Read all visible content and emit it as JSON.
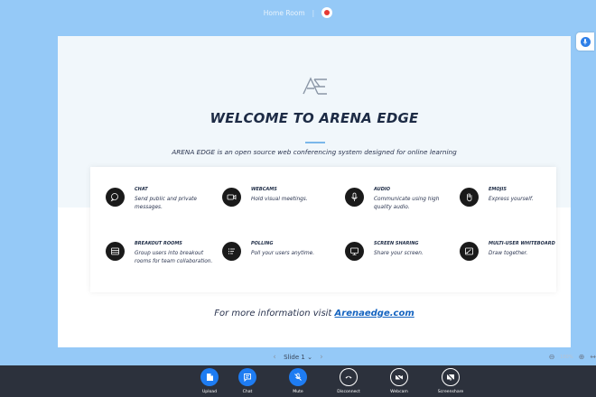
{
  "room": {
    "name": "Home Room",
    "separator": "|"
  },
  "slide": {
    "welcome_title": "WELCOME TO ARENA EDGE",
    "subtitle": "ARENA EDGE is an open source web conferencing system designed for online learning",
    "features": [
      {
        "title": "CHAT",
        "desc": "Send public and private messages.",
        "icon": "chat-bubble-icon"
      },
      {
        "title": "WEBCAMS",
        "desc": "Hold visual meetings.",
        "icon": "webcam-icon"
      },
      {
        "title": "AUDIO",
        "desc": "Communicate using high quality audio.",
        "icon": "microphone-icon"
      },
      {
        "title": "EMOJIS",
        "desc": "Express yourself.",
        "icon": "hand-icon"
      },
      {
        "title": "BREAKOUT ROOMS",
        "desc": "Group users into breakout rooms for team collaboration.",
        "icon": "breakout-rooms-icon"
      },
      {
        "title": "POLLING",
        "desc": "Poll your users anytime.",
        "icon": "polling-icon"
      },
      {
        "title": "SCREEN SHARING",
        "desc": "Share your screen.",
        "icon": "monitor-icon"
      },
      {
        "title": "MULTI-USER WHITEBOARD",
        "desc": "Draw together.",
        "icon": "whiteboard-icon"
      }
    ],
    "more_info_prefix": "For more information visit ",
    "more_info_link": "Arenaedge.com"
  },
  "slide_nav": {
    "current": "Slide 1",
    "prev": "‹",
    "next": "›",
    "dropdown": "⌄"
  },
  "zoom": {
    "minus": "⊖",
    "level": "100%",
    "plus": "⊕",
    "fit": "↔"
  },
  "toolbar": {
    "buttons": [
      {
        "label": "Upload",
        "icon": "upload-file-icon",
        "style": "blue"
      },
      {
        "label": "Chat",
        "icon": "chat-icon",
        "style": "blue"
      },
      {
        "label": "Mute",
        "icon": "mic-off-icon",
        "style": "blue"
      },
      {
        "label": "Disconnect",
        "icon": "phone-icon",
        "style": "dark"
      },
      {
        "label": "Webcam",
        "icon": "video-off-icon",
        "style": "dark"
      },
      {
        "label": "Screenshare",
        "icon": "screenshare-off-icon",
        "style": "dark"
      }
    ]
  },
  "colors": {
    "background": "#95c9f7",
    "accent": "#1e7cf2",
    "bar": "#2c313c",
    "record": "#e53935",
    "link": "#1564c0"
  }
}
